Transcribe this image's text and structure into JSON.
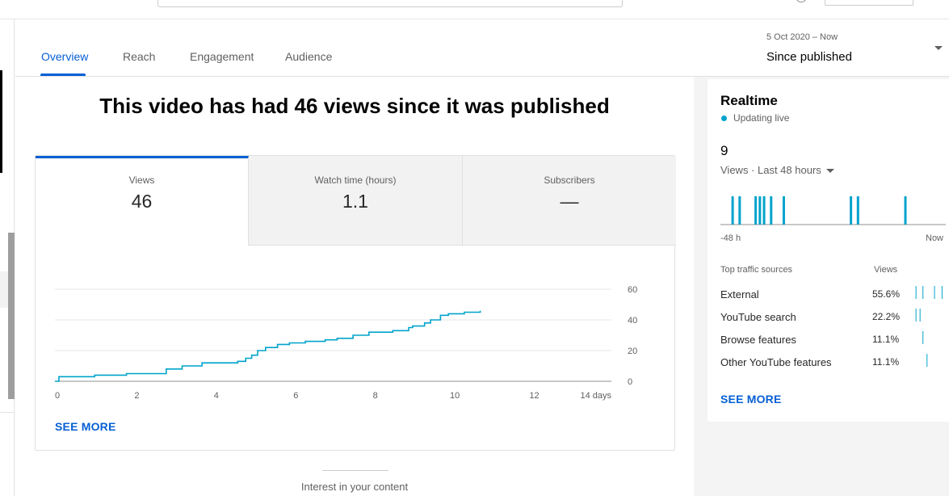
{
  "tabs": [
    {
      "label": "Overview",
      "active": true
    },
    {
      "label": "Reach",
      "active": false
    },
    {
      "label": "Engagement",
      "active": false
    },
    {
      "label": "Audience",
      "active": false
    }
  ],
  "date_range": {
    "range": "5 Oct 2020 – Now",
    "selected": "Since published"
  },
  "headline": "This video has had 46 views since it was published",
  "metrics": [
    {
      "label": "Views",
      "value": "46"
    },
    {
      "label": "Watch time (hours)",
      "value": "1.1"
    },
    {
      "label": "Subscribers",
      "value": "—"
    }
  ],
  "see_more_label": "SEE MORE",
  "bottom_text": "Interest in your content",
  "accent_color": "#065fd4",
  "series_color": "#00a3cc",
  "chart_data": {
    "type": "line",
    "series": [
      {
        "x": [
          0,
          0.1,
          1,
          1.8,
          2.7,
          2.8,
          3.2,
          3.7,
          4.6,
          4.8,
          4.95,
          5.1,
          5.3,
          5.6,
          5.9,
          6.3,
          6.8,
          7.1,
          7.5,
          7.9,
          8.5,
          8.9,
          9.0,
          9.3,
          9.45,
          9.7,
          9.9,
          10.3,
          10.7
        ],
        "y": [
          0,
          3,
          4,
          5,
          5,
          8,
          10,
          12,
          13,
          15,
          17,
          20,
          22,
          24,
          25,
          26,
          27,
          28,
          30,
          32,
          33,
          35,
          36,
          38,
          40,
          43,
          44,
          45,
          46
        ]
      }
    ],
    "x_ticks": [
      "0",
      "2",
      "4",
      "6",
      "8",
      "10",
      "12",
      "14 days"
    ],
    "y_ticks": [
      "0",
      "20",
      "40",
      "60"
    ],
    "xlim": [
      0,
      14
    ],
    "ylim": [
      0,
      60
    ],
    "grid": true
  },
  "realtime": {
    "title": "Realtime",
    "status": "Updating live",
    "count": "9",
    "period": "Views · Last 48 hours",
    "axis_start": "-48 h",
    "axis_end": "Now",
    "bar_hours": [
      -45.4,
      -43.9,
      -40.5,
      -39.6,
      -38.7,
      -37.2,
      -34.5,
      -20.2,
      -18.7,
      -8.6
    ],
    "sources_header": "Top traffic sources",
    "views_header": "Views",
    "sources": [
      {
        "name": "External",
        "pct": "55.6%",
        "bars": [
          0.3,
          1.5,
          3.5,
          4.8
        ]
      },
      {
        "name": "YouTube search",
        "pct": "22.2%",
        "bars": [
          0.3,
          1.0
        ]
      },
      {
        "name": "Browse features",
        "pct": "11.1%",
        "bars": [
          1.5
        ]
      },
      {
        "name": "Other YouTube features",
        "pct": "11.1%",
        "bars": [
          2.2
        ]
      }
    ]
  }
}
